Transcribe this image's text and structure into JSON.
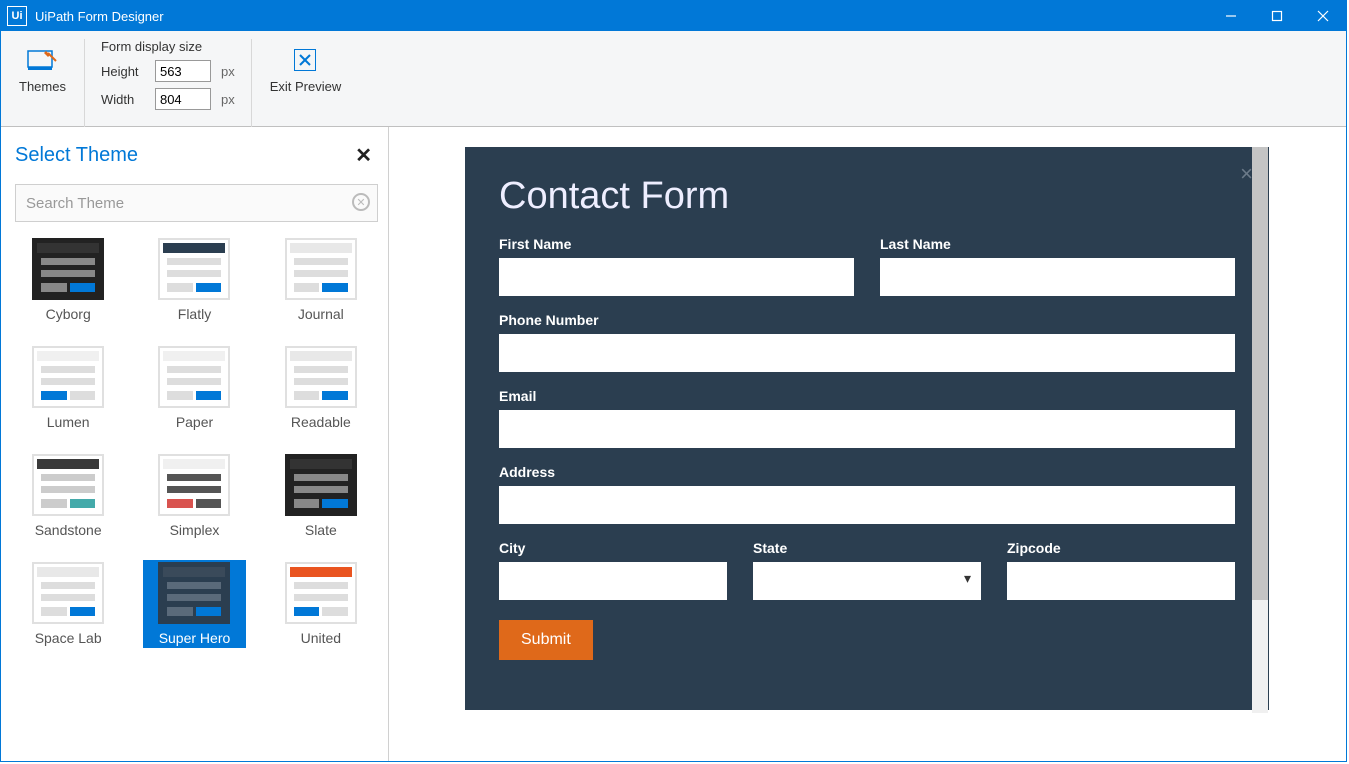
{
  "window": {
    "title": "UiPath Form Designer"
  },
  "toolbar": {
    "themes_label": "Themes",
    "form_size_heading": "Form display size",
    "height_label": "Height",
    "width_label": "Width",
    "height_value": "563",
    "width_value": "804",
    "px_unit": "px",
    "exit_preview_label": "Exit Preview"
  },
  "sidebar": {
    "title": "Select Theme",
    "search_placeholder": "Search Theme",
    "themes": [
      {
        "name": "Cyborg",
        "selected": false,
        "style": "dark"
      },
      {
        "name": "Flatly",
        "selected": false,
        "style": "flatly"
      },
      {
        "name": "Journal",
        "selected": false,
        "style": "light"
      },
      {
        "name": "Lumen",
        "selected": false,
        "style": "lumen"
      },
      {
        "name": "Paper",
        "selected": false,
        "style": "paper"
      },
      {
        "name": "Readable",
        "selected": false,
        "style": "light"
      },
      {
        "name": "Sandstone",
        "selected": false,
        "style": "sandstone"
      },
      {
        "name": "Simplex",
        "selected": false,
        "style": "simplex"
      },
      {
        "name": "Slate",
        "selected": false,
        "style": "dark"
      },
      {
        "name": "Space Lab",
        "selected": false,
        "style": "light"
      },
      {
        "name": "Super Hero",
        "selected": true,
        "style": "superhero"
      },
      {
        "name": "United",
        "selected": false,
        "style": "united"
      }
    ]
  },
  "form": {
    "title": "Contact Form",
    "fields": {
      "first_name": "First Name",
      "last_name": "Last Name",
      "phone": "Phone Number",
      "email": "Email",
      "address": "Address",
      "city": "City",
      "state": "State",
      "zipcode": "Zipcode"
    },
    "submit_label": "Submit"
  }
}
